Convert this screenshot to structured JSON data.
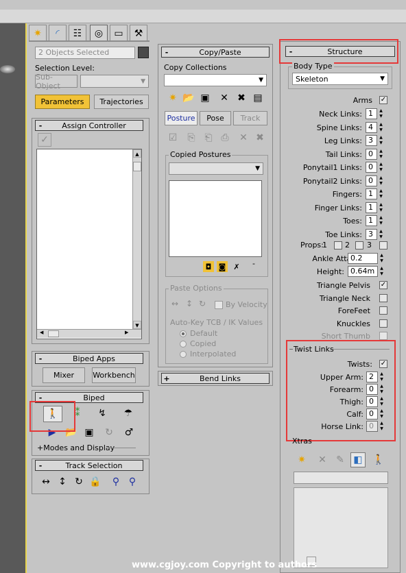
{
  "object_name": {
    "value": "2 Objects Selected"
  },
  "selection_level": {
    "label": "Selection Level:",
    "sub_object": "Sub-Object"
  },
  "motion_buttons": {
    "parameters": "Parameters",
    "trajectories": "Trajectories"
  },
  "assign_controller": {
    "title": "Assign Controller"
  },
  "biped_apps": {
    "title": "Biped Apps",
    "mixer": "Mixer",
    "workbench": "Workbench"
  },
  "biped": {
    "title": "Biped",
    "modes_and_display": "Modes and Display"
  },
  "track_selection": {
    "title": "Track Selection"
  },
  "copy_paste": {
    "title": "Copy/Paste",
    "copy_collections_label": "Copy Collections",
    "tabs": [
      "Posture",
      "Pose",
      "Track"
    ],
    "copied_postures_label": "Copied Postures",
    "paste_options_label": "Paste Options",
    "by_velocity": "By Velocity",
    "auto_key_label": "Auto-Key TCB / IK Values",
    "radio_options": [
      "Default",
      "Copied",
      "Interpolated"
    ],
    "minus_label": "-"
  },
  "bend_links": {
    "title": "Bend Links"
  },
  "structure": {
    "title": "Structure",
    "body_type_label": "Body Type",
    "body_type_value": "Skeleton",
    "arms_label": "Arms",
    "rows": [
      {
        "label": "Neck Links:",
        "value": "1"
      },
      {
        "label": "Spine Links:",
        "value": "4"
      },
      {
        "label": "Leg Links:",
        "value": "3"
      },
      {
        "label": "Tail Links:",
        "value": "0"
      },
      {
        "label": "Ponytail1 Links:",
        "value": "0"
      },
      {
        "label": "Ponytail2 Links:",
        "value": "0"
      },
      {
        "label": "Fingers:",
        "value": "1"
      },
      {
        "label": "Finger Links:",
        "value": "1"
      },
      {
        "label": "Toes:",
        "value": "1"
      },
      {
        "label": "Toe Links:",
        "value": "3"
      }
    ],
    "props_label": "Props:",
    "props_options": [
      "1",
      "2",
      "3"
    ],
    "ankle_attach": {
      "label": "Ankle Attach:",
      "value": "0.2"
    },
    "height": {
      "label": "Height:",
      "value": "0.64m"
    },
    "checkboxes": [
      {
        "label": "Triangle Pelvis",
        "checked": true
      },
      {
        "label": "Triangle Neck",
        "checked": false
      },
      {
        "label": "ForeFeet",
        "checked": false
      },
      {
        "label": "Knuckles",
        "checked": false
      },
      {
        "label": "Short Thumb",
        "checked": false
      }
    ]
  },
  "twist_links": {
    "title": "Twist Links",
    "twists_label": "Twists:",
    "rows": [
      {
        "label": "Upper Arm:",
        "value": "2"
      },
      {
        "label": "Forearm:",
        "value": "0"
      },
      {
        "label": "Thigh:",
        "value": "0"
      },
      {
        "label": "Calf:",
        "value": "0"
      },
      {
        "label": "Horse Link:",
        "value": "0"
      }
    ]
  },
  "xtras": {
    "title": "Xtras"
  },
  "watermark": "www.cgjoy.com Copyright to authors",
  "colors": {
    "highlight_red": "#e53838",
    "parameters_yellow": "#f1c237",
    "viewport_border": "#e8d44d"
  }
}
